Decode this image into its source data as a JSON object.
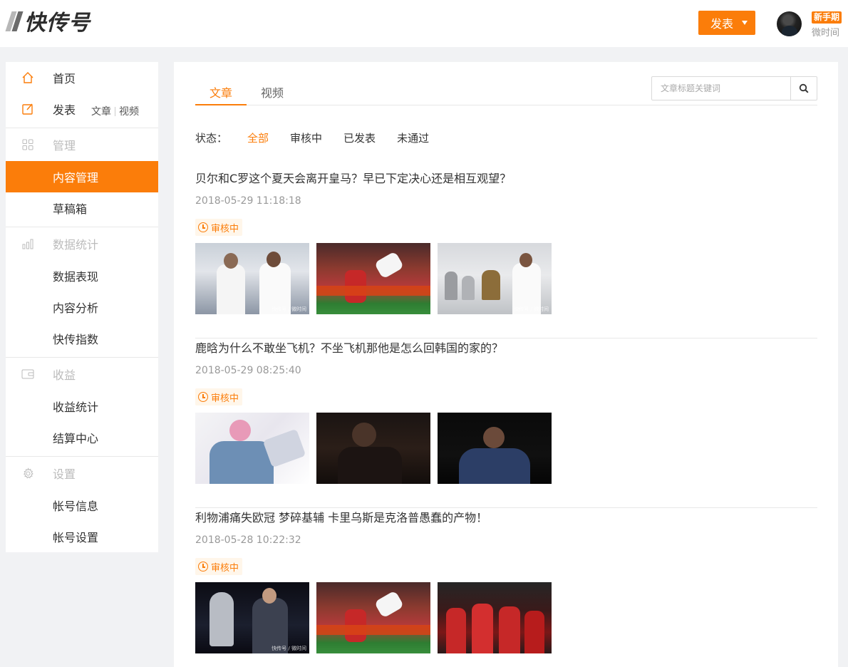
{
  "header": {
    "logo_text": "快传号",
    "publish_label": "发表",
    "user_badge": "新手期",
    "user_name": "微时间"
  },
  "sidebar": {
    "home": "首页",
    "publish": "发表",
    "publish_links": [
      "文章",
      "视频"
    ],
    "sections": [
      {
        "title": "管理",
        "icon": "grid-icon",
        "items": [
          "内容管理",
          "草稿箱"
        ]
      },
      {
        "title": "数据统计",
        "icon": "bar-chart-icon",
        "items": [
          "数据表现",
          "内容分析",
          "快传指数"
        ]
      },
      {
        "title": "收益",
        "icon": "wallet-icon",
        "items": [
          "收益统计",
          "结算中心"
        ]
      },
      {
        "title": "设置",
        "icon": "gear-icon",
        "items": [
          "帐号信息",
          "帐号设置"
        ]
      }
    ],
    "active_item": "内容管理"
  },
  "main": {
    "tabs": [
      "文章",
      "视频"
    ],
    "active_tab": "文章",
    "search_placeholder": "文章标题关键词",
    "filter_label": "状态：",
    "filters": [
      "全部",
      "审核中",
      "已发表",
      "未通过"
    ],
    "active_filter": "全部",
    "articles": [
      {
        "title": "贝尔和C罗这个夏天会离开皇马？早已下定决心还是相互观望？",
        "date": "2018-05-29 11:18:18",
        "status": "审核中",
        "watermark": "快传号 / 微时间"
      },
      {
        "title": "鹿晗为什么不敢坐飞机？不坐飞机那他是怎么回韩国的家的？",
        "date": "2018-05-29 08:25:40",
        "status": "审核中",
        "watermark": ""
      },
      {
        "title": "利物浦痛失欧冠 梦碎基辅 卡里乌斯是克洛普愚蠢的产物！",
        "date": "2018-05-28 10:22:32",
        "status": "审核中",
        "watermark": "快传号 / 微时间"
      }
    ]
  },
  "colors": {
    "accent": "#fb7d0a",
    "muted": "#999999",
    "section": "#bbbbbb"
  }
}
